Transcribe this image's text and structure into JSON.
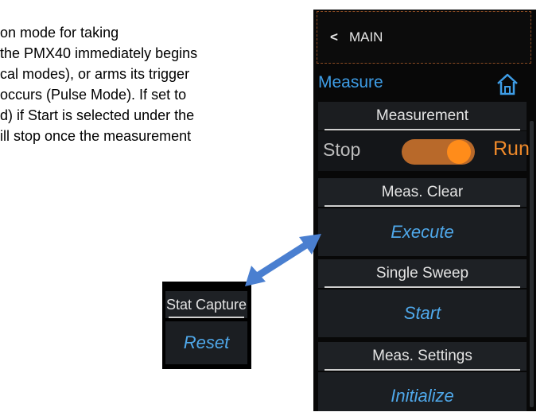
{
  "doc": {
    "lines": [
      "on mode for taking",
      "the PMX40 immediately begins",
      "cal modes), or arms its trigger",
      "occurs (Pulse Mode). If set to",
      "d) if Start is selected under the",
      "ill stop once the measurement"
    ]
  },
  "device": {
    "back_label": "MAIN",
    "back_chevron": "<",
    "title": "Measure",
    "measurement": {
      "header": "Measurement",
      "stop_label": "Stop",
      "run_label": "Run",
      "toggle_state": "Run"
    },
    "meas_clear": {
      "header": "Meas. Clear",
      "button": "Execute"
    },
    "single_sweep": {
      "header": "Single Sweep",
      "button": "Start"
    },
    "meas_settings": {
      "header": "Meas. Settings",
      "button": "Initialize"
    }
  },
  "inset": {
    "header": "Stat Capture",
    "button": "Reset"
  },
  "colors": {
    "accent_blue": "#4fa8ea",
    "title_blue": "#3e9de6",
    "run_orange": "#f08a2a",
    "arrow_blue": "#4a7fd0"
  },
  "icons": [
    "home-icon",
    "double-arrow-icon"
  ]
}
